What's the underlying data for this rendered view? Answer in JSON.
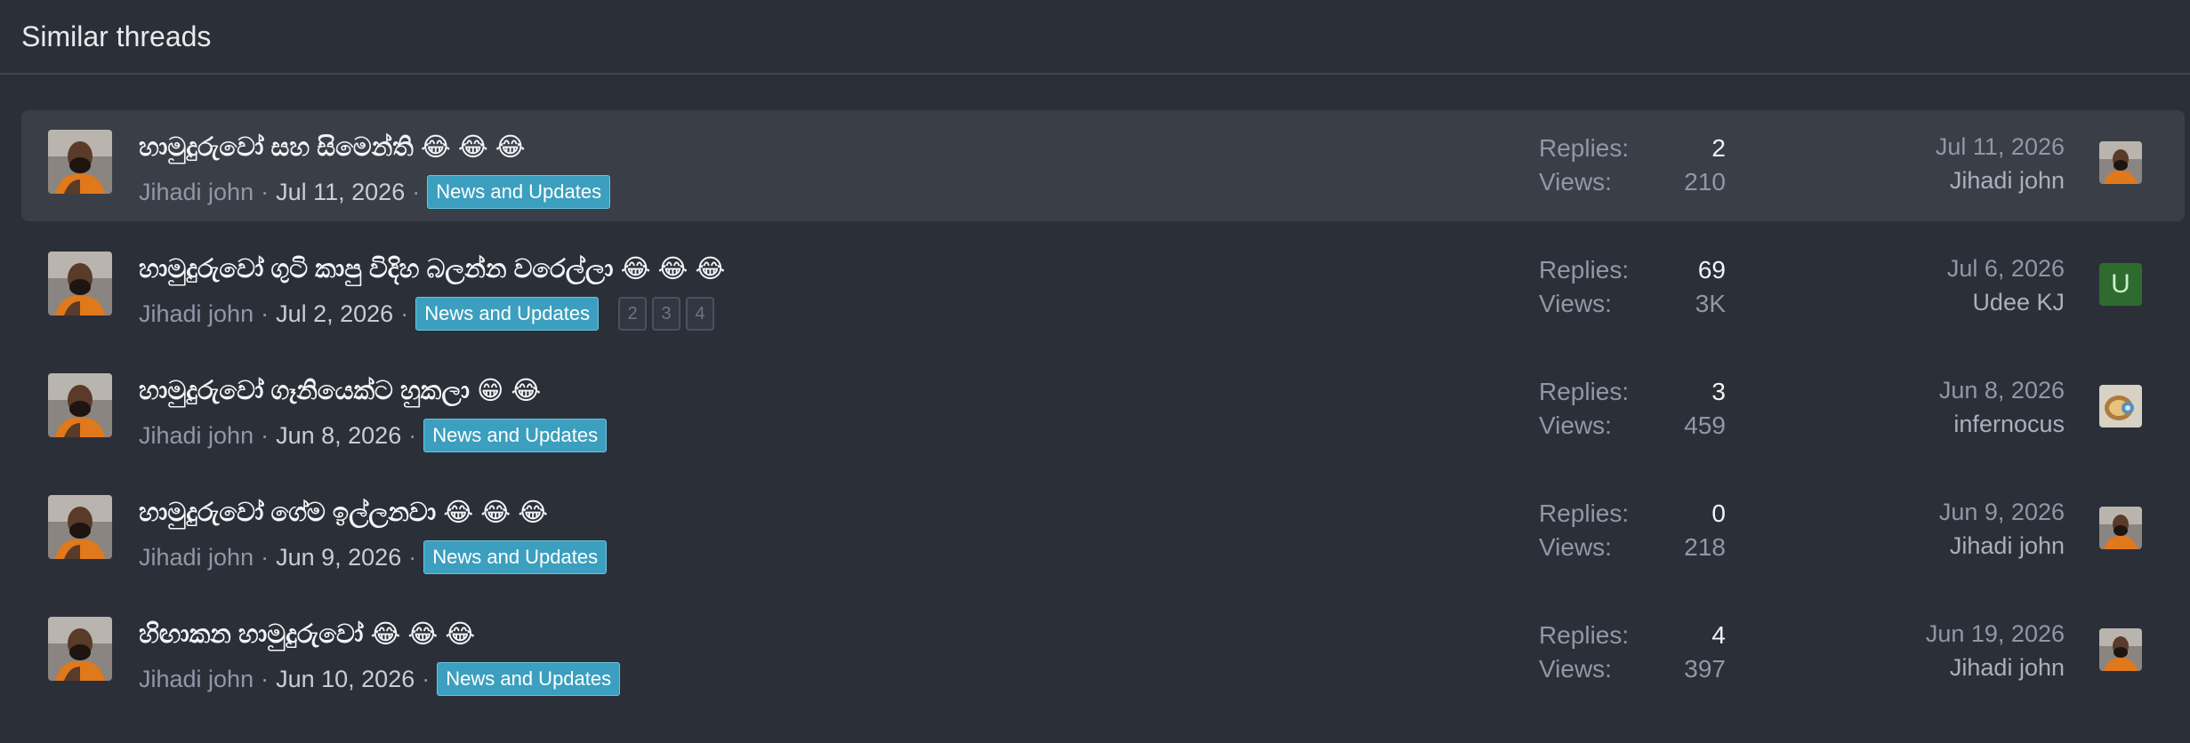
{
  "header": {
    "title": "Similar threads"
  },
  "colors": {
    "tag_bg": "#3c9fbf",
    "highlight_row": "#3a3e47",
    "letter_avatar_bg": "#2f6b2e"
  },
  "labels": {
    "replies": "Replies:",
    "views": "Views:",
    "dot": "·"
  },
  "threads": [
    {
      "title": "හාමුදුරුවෝ සහ සිමෙන්ති",
      "emojis": "😂 😂 😂",
      "author": "Jihadi john",
      "date": "Jul 11, 2026",
      "tag": "News and Updates",
      "pages": [],
      "replies": "2",
      "views": "210",
      "last_date": "Jul 11, 2026",
      "last_user": "Jihadi john",
      "last_avatar": "monk-photo"
    },
    {
      "title": "හාමුදුරුවෝ ගුටි කාපු විදිහ බලන්න වරෙල්ලා",
      "emojis": "😂 😂 😂",
      "author": "Jihadi john",
      "date": "Jul 2, 2026",
      "tag": "News and Updates",
      "pages": [
        "2",
        "3",
        "4"
      ],
      "replies": "69",
      "views": "3K",
      "last_date": "Jul 6, 2026",
      "last_user": "Udee KJ",
      "last_avatar_letter": "U"
    },
    {
      "title": "හාමුදුරුවෝ ගෑනියෙක්ට හුකලා",
      "emojis": "😁 😂",
      "author": "Jihadi john",
      "date": "Jun 8, 2026",
      "tag": "News and Updates",
      "pages": [],
      "replies": "3",
      "views": "459",
      "last_date": "Jun 8, 2026",
      "last_user": "infernocus",
      "last_avatar": "robot-photo"
    },
    {
      "title": "හාමුදුරුවෝ ගේම ඉල්ලනවා",
      "emojis": "😂 😂 😂",
      "author": "Jihadi john",
      "date": "Jun 9, 2026",
      "tag": "News and Updates",
      "pages": [],
      "replies": "0",
      "views": "218",
      "last_date": "Jun 9, 2026",
      "last_user": "Jihadi john",
      "last_avatar": "monk-photo"
    },
    {
      "title": "හිඟාකන හාමුදුරුවෝ",
      "emojis": "😂 😂 😂",
      "author": "Jihadi john",
      "date": "Jun 10, 2026",
      "tag": "News and Updates",
      "pages": [],
      "replies": "4",
      "views": "397",
      "last_date": "Jun 19, 2026",
      "last_user": "Jihadi john",
      "last_avatar": "monk-photo"
    }
  ]
}
